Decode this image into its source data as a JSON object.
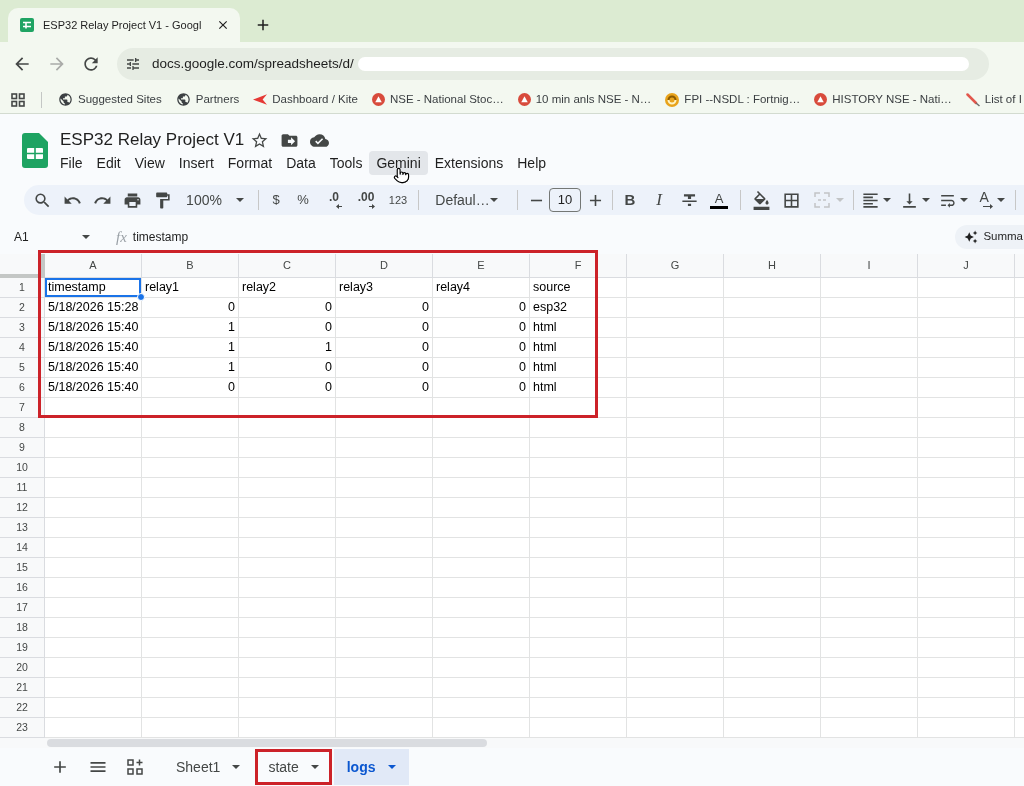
{
  "browser": {
    "tab": {
      "title": "ESP32 Relay Project V1 - Googl"
    },
    "address": {
      "text": "docs.google.com/spreadsheets/d/",
      "redacted": true
    },
    "bookmarks": [
      {
        "label": "Suggested Sites",
        "kind": "globe"
      },
      {
        "label": "Partners",
        "kind": "globe"
      },
      {
        "label": "Dashboard / Kite",
        "kind": "chevron"
      },
      {
        "label": "NSE - National Stoc…",
        "kind": "disc"
      },
      {
        "label": "10 min anls NSE - N…",
        "kind": "disc"
      },
      {
        "label": "FPI --NSDL : Fortnig…",
        "kind": "swirl"
      },
      {
        "label": "HISTORY NSE - Nati…",
        "kind": "disc"
      },
      {
        "label": "List of I",
        "kind": "quill"
      }
    ]
  },
  "document": {
    "title": "ESP32 Relay Project V1",
    "menu": [
      {
        "label": "File",
        "hovered": false
      },
      {
        "label": "Edit",
        "hovered": false
      },
      {
        "label": "View",
        "hovered": false
      },
      {
        "label": "Insert",
        "hovered": false
      },
      {
        "label": "Format",
        "hovered": false
      },
      {
        "label": "Data",
        "hovered": false
      },
      {
        "label": "Tools",
        "hovered": false
      },
      {
        "label": "Gemini",
        "hovered": true
      },
      {
        "label": "Extensions",
        "hovered": false
      },
      {
        "label": "Help",
        "hovered": false
      }
    ]
  },
  "toolbar": {
    "zoom": "100%",
    "currency": "$",
    "percent": "%",
    "decrease_decimals": ".0",
    "increase_decimals": ".00",
    "number_format": "123",
    "font": "Defaul…",
    "font_size": "10",
    "bold": "B",
    "italic": "I",
    "text_color": "A",
    "text_rotation": "A",
    "merge_disabled": true
  },
  "formula_bar": {
    "cell": "A1",
    "fx": "fx",
    "content": "timestamp"
  },
  "summary_button": "Summa",
  "grid": {
    "outlined": true,
    "columns": [
      "A",
      "B",
      "C",
      "D",
      "E",
      "F",
      "G",
      "H",
      "I",
      "J"
    ],
    "rows": [
      {
        "number": "1",
        "cells": [
          {
            "value": "timestamp",
            "kind": "text",
            "selected": true
          },
          {
            "value": "relay1",
            "kind": "text",
            "selected": false
          },
          {
            "value": "relay2",
            "kind": "text",
            "selected": false
          },
          {
            "value": "relay3",
            "kind": "text",
            "selected": false
          },
          {
            "value": "relay4",
            "kind": "text",
            "selected": false
          },
          {
            "value": "source",
            "kind": "text",
            "selected": false
          }
        ]
      },
      {
        "number": "2",
        "cells": [
          {
            "value": "5/18/2026 15:28",
            "kind": "text",
            "selected": false
          },
          {
            "value": "0",
            "kind": "number",
            "selected": false
          },
          {
            "value": "0",
            "kind": "number",
            "selected": false
          },
          {
            "value": "0",
            "kind": "number",
            "selected": false
          },
          {
            "value": "0",
            "kind": "number",
            "selected": false
          },
          {
            "value": "esp32",
            "kind": "text",
            "selected": false
          }
        ]
      },
      {
        "number": "3",
        "cells": [
          {
            "value": "5/18/2026 15:40",
            "kind": "text",
            "selected": false
          },
          {
            "value": "1",
            "kind": "number",
            "selected": false
          },
          {
            "value": "0",
            "kind": "number",
            "selected": false
          },
          {
            "value": "0",
            "kind": "number",
            "selected": false
          },
          {
            "value": "0",
            "kind": "number",
            "selected": false
          },
          {
            "value": "html",
            "kind": "text",
            "selected": false
          }
        ]
      },
      {
        "number": "4",
        "cells": [
          {
            "value": "5/18/2026 15:40",
            "kind": "text",
            "selected": false
          },
          {
            "value": "1",
            "kind": "number",
            "selected": false
          },
          {
            "value": "1",
            "kind": "number",
            "selected": false
          },
          {
            "value": "0",
            "kind": "number",
            "selected": false
          },
          {
            "value": "0",
            "kind": "number",
            "selected": false
          },
          {
            "value": "html",
            "kind": "text",
            "selected": false
          }
        ]
      },
      {
        "number": "5",
        "cells": [
          {
            "value": "5/18/2026 15:40",
            "kind": "text",
            "selected": false
          },
          {
            "value": "1",
            "kind": "number",
            "selected": false
          },
          {
            "value": "0",
            "kind": "number",
            "selected": false
          },
          {
            "value": "0",
            "kind": "number",
            "selected": false
          },
          {
            "value": "0",
            "kind": "number",
            "selected": false
          },
          {
            "value": "html",
            "kind": "text",
            "selected": false
          }
        ]
      },
      {
        "number": "6",
        "cells": [
          {
            "value": "5/18/2026 15:40",
            "kind": "text",
            "selected": false
          },
          {
            "value": "0",
            "kind": "number",
            "selected": false
          },
          {
            "value": "0",
            "kind": "number",
            "selected": false
          },
          {
            "value": "0",
            "kind": "number",
            "selected": false
          },
          {
            "value": "0",
            "kind": "number",
            "selected": false
          },
          {
            "value": "html",
            "kind": "text",
            "selected": false
          }
        ]
      },
      {
        "number": "7"
      },
      {
        "number": "8"
      },
      {
        "number": "9"
      },
      {
        "number": "10"
      },
      {
        "number": "11"
      },
      {
        "number": "12"
      },
      {
        "number": "13"
      },
      {
        "number": "14"
      },
      {
        "number": "15"
      },
      {
        "number": "16"
      },
      {
        "number": "17"
      },
      {
        "number": "18"
      },
      {
        "number": "19"
      },
      {
        "number": "20"
      },
      {
        "number": "21"
      },
      {
        "number": "22"
      },
      {
        "number": "23"
      }
    ]
  },
  "sheet_tabs": [
    {
      "label": "Sheet1",
      "selected": false,
      "outlined": false
    },
    {
      "label": "state",
      "selected": false,
      "outlined": true
    },
    {
      "label": "logs",
      "selected": true,
      "outlined": false
    }
  ]
}
